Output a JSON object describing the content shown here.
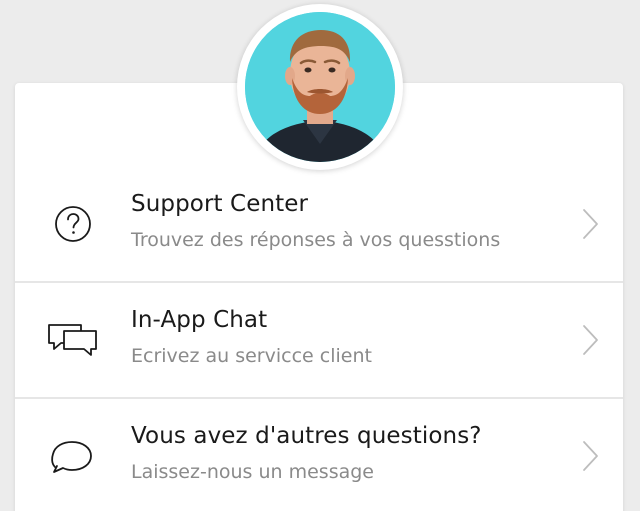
{
  "agent": {
    "avatar_icon": "agent-photo",
    "avatar_bg": "#4fd3de"
  },
  "menu": {
    "items": [
      {
        "icon": "question-circle-icon",
        "title": "Support Center",
        "subtitle": "Trouvez des réponses à vos quesstions"
      },
      {
        "icon": "chat-bubbles-icon",
        "title": "In-App Chat",
        "subtitle": "Ecrivez au servicce client"
      },
      {
        "icon": "speech-bubble-icon",
        "title": "Vous avez d'autres questions?",
        "subtitle": "Laissez-nous un message"
      }
    ],
    "chevron_icon": "chevron-right-icon"
  }
}
